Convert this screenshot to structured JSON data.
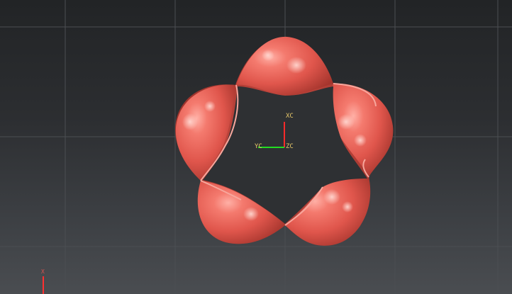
{
  "viewport": {
    "background_top": "#222426",
    "background_bottom": "#4a4d51",
    "grid_color": "#4b4e52",
    "model_color": "#e85a50"
  },
  "wcs": {
    "x_label": "XC",
    "y_label": "YC",
    "z_label": "ZC",
    "x_color": "#ff2a2a",
    "y_color": "#22dd22"
  },
  "triad": {
    "x_label": "X",
    "x_color": "#ff3030"
  },
  "model": {
    "icon": "twisted-ribbon-model"
  }
}
